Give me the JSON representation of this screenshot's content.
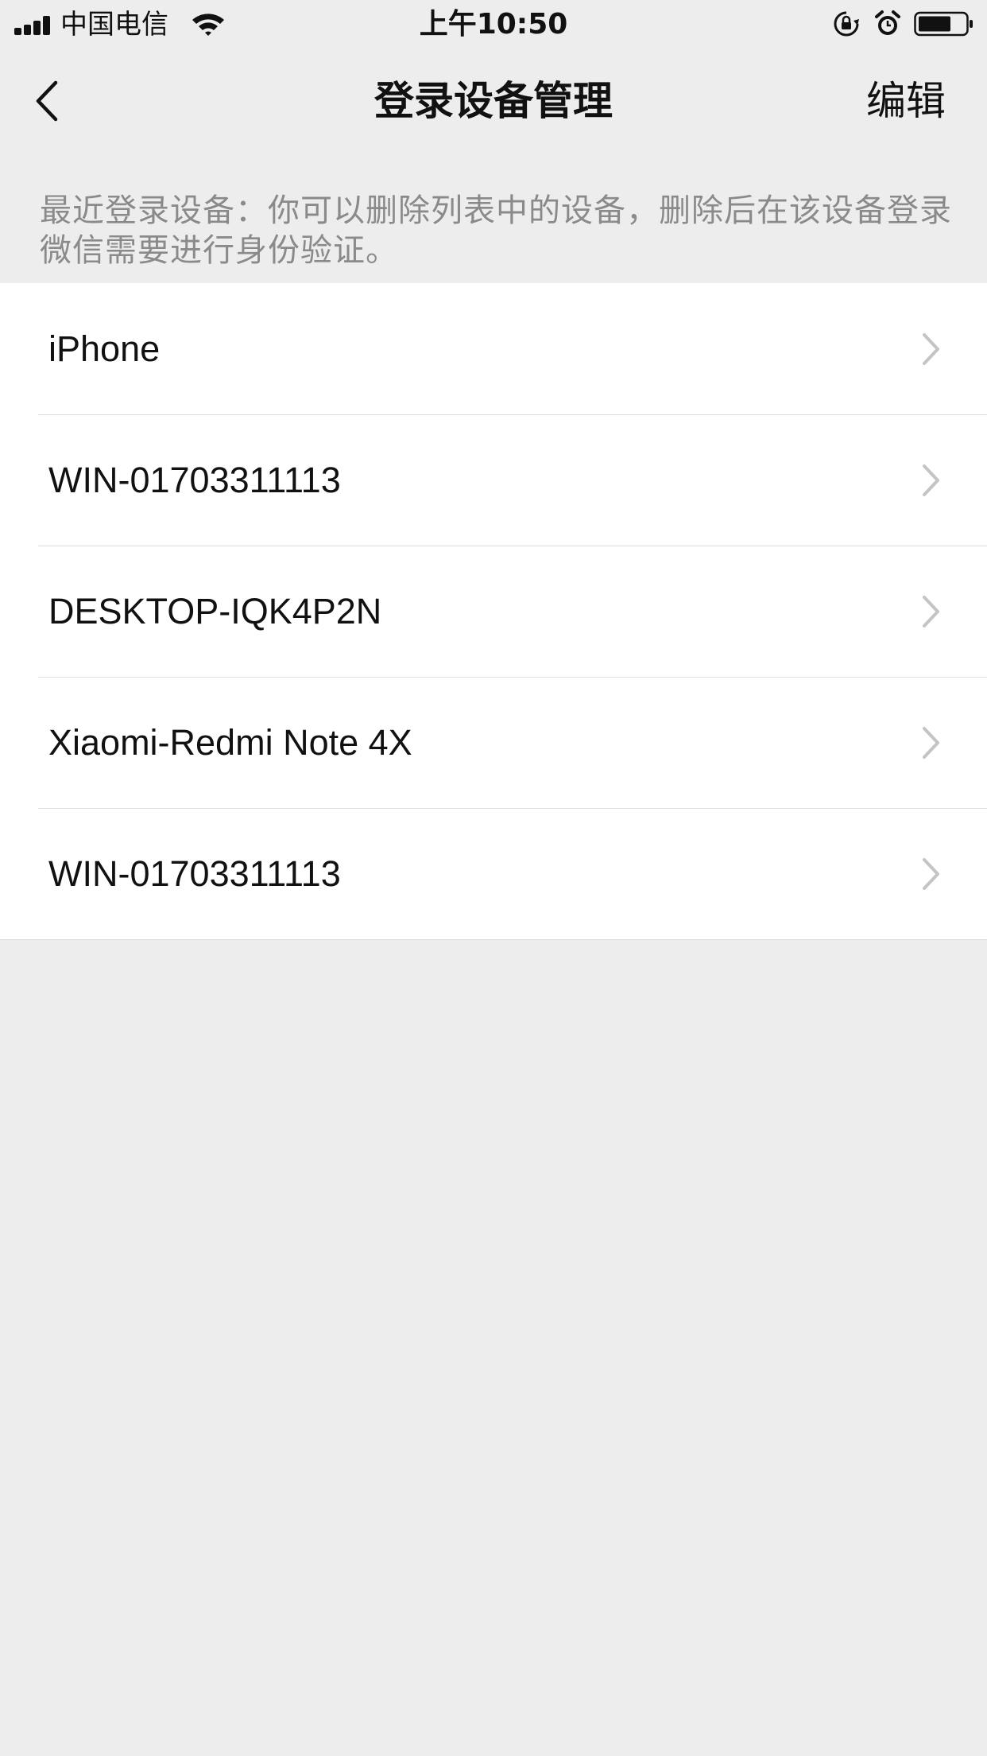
{
  "status_bar": {
    "carrier": "中国电信",
    "time": "上午10:50",
    "icons": [
      "signal-icon",
      "wifi-icon",
      "rotation-lock-icon",
      "alarm-icon",
      "battery-icon"
    ]
  },
  "nav": {
    "back_icon": "chevron-left-icon",
    "title": "登录设备管理",
    "edit_label": "编辑"
  },
  "hint": "最近登录设备：你可以删除列表中的设备，删除后在该设备登录微信需要进行身份验证。",
  "devices": [
    {
      "name": "iPhone"
    },
    {
      "name": "WIN-01703311113"
    },
    {
      "name": "DESKTOP-IQK4P2N"
    },
    {
      "name": "Xiaomi-Redmi Note 4X"
    },
    {
      "name": "WIN-01703311113"
    }
  ],
  "colors": {
    "page_background": "#ededed",
    "list_background": "#ffffff",
    "hint_text": "#8a8a8a",
    "chevron": "#c4c4c4"
  }
}
